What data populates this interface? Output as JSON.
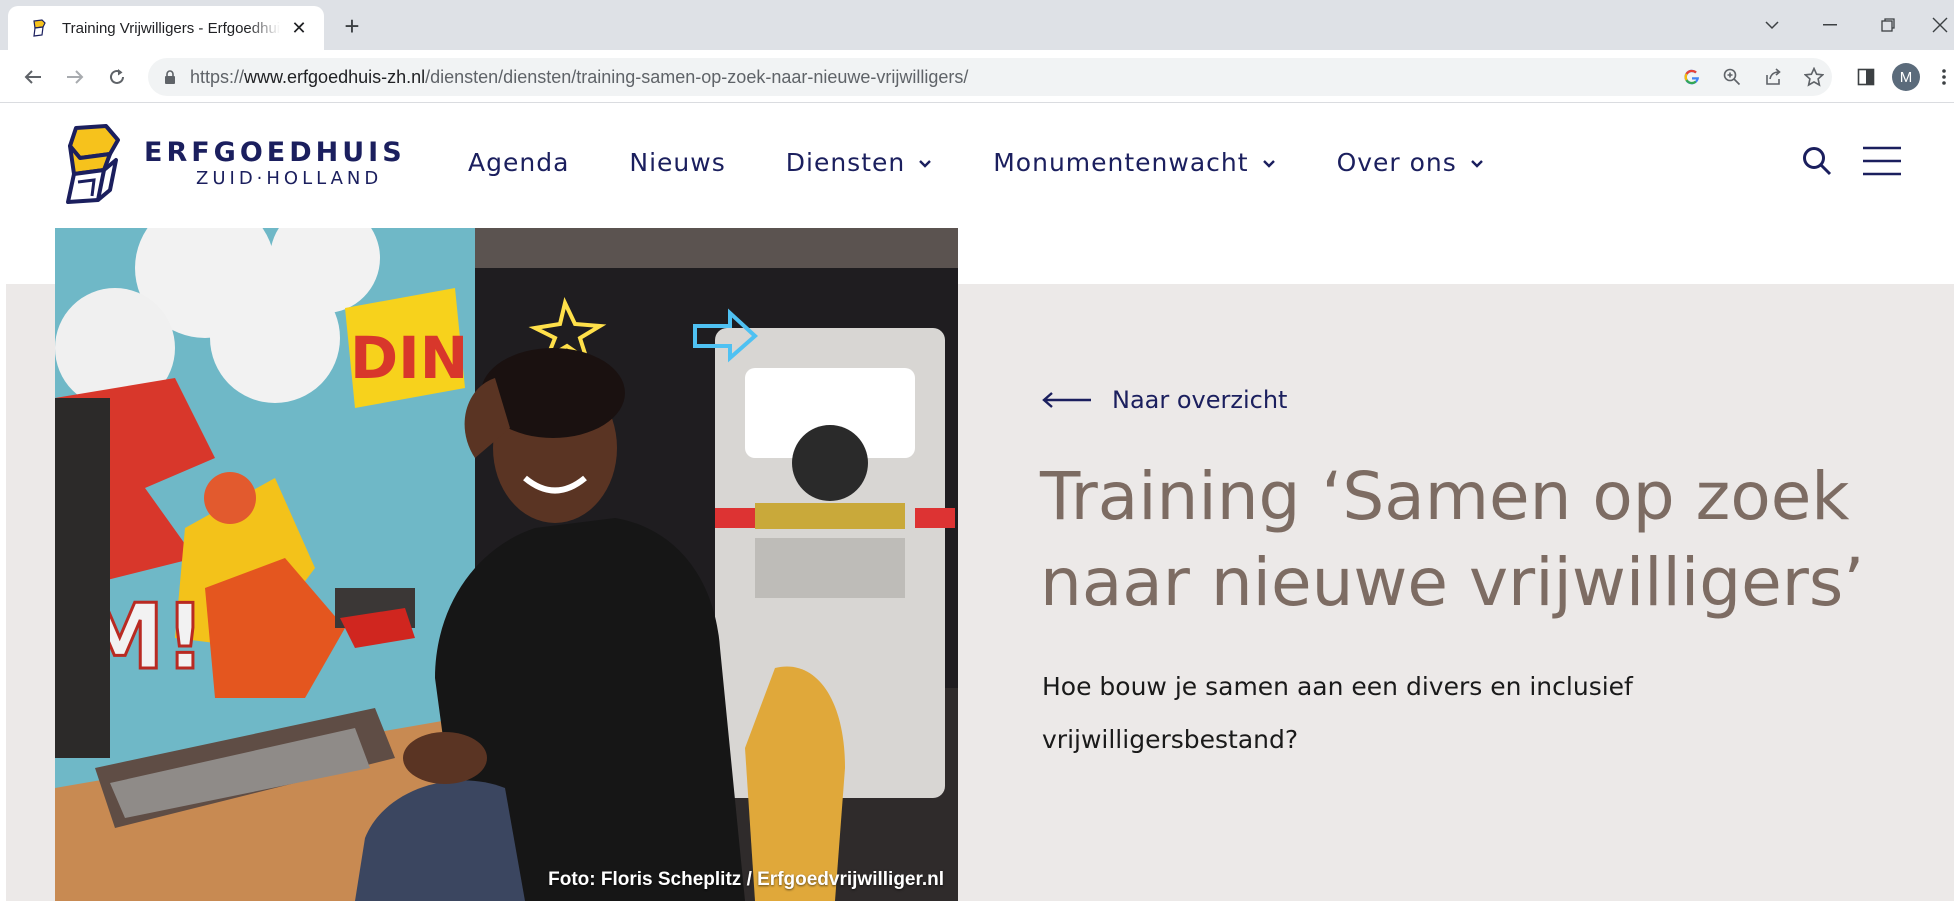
{
  "browser": {
    "tab_title": "Training Vrijwilligers - Erfgoedhuis Zuid-Holland",
    "new_tab_symbol": "+",
    "url_scheme": "https://",
    "url_host": "www.erfgoedhuis-zh.nl",
    "url_path": "/diensten/diensten/training-samen-op-zoek-naar-nieuwe-vrijwilligers/",
    "profile_initial": "M"
  },
  "site": {
    "logo_line1": "ERFGOEDHUIS",
    "logo_line2": "ZUID·HOLLAND",
    "colors": {
      "navy": "#1b1f5e",
      "accent": "#f6c21c",
      "title": "#7d6c63",
      "band": "#ece9e8"
    },
    "nav": [
      {
        "label": "Agenda",
        "has_dropdown": false
      },
      {
        "label": "Nieuws",
        "has_dropdown": false
      },
      {
        "label": "Diensten",
        "has_dropdown": true
      },
      {
        "label": "Monumentenwacht",
        "has_dropdown": true
      },
      {
        "label": "Over ons",
        "has_dropdown": true
      }
    ]
  },
  "hero": {
    "back_label": "Naar overzicht",
    "title": "Training ‘Samen op zoek naar nieuwe vrijwilligers’",
    "lead": "Hoe bouw je samen aan een divers en inclusief vrijwilligersbestand?",
    "photo_credit": "Foto: Floris Scheplitz / Erfgoedvrijwilliger.nl"
  }
}
